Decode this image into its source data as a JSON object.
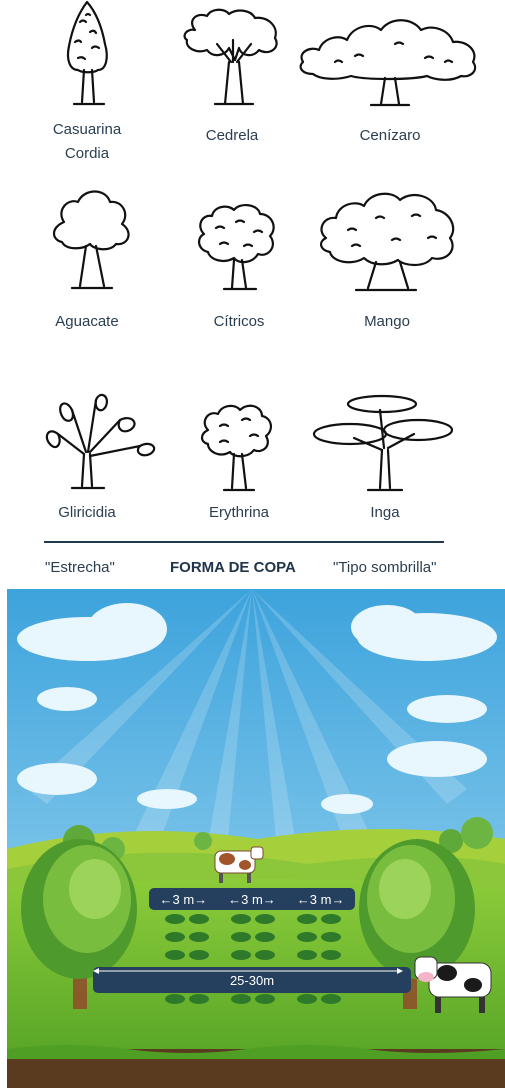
{
  "trees": [
    {
      "label": "Casuarina\nCordia",
      "shape": "narrow-conifer"
    },
    {
      "label": "Cedrela",
      "shape": "vase"
    },
    {
      "label": "Cenízaro",
      "shape": "wide-umbrella"
    },
    {
      "label": "Aguacate",
      "shape": "round-small"
    },
    {
      "label": "Cítricos",
      "shape": "round-dense"
    },
    {
      "label": "Mango",
      "shape": "broad-round"
    },
    {
      "label": "Gliricidia",
      "shape": "fan-leaves"
    },
    {
      "label": "Erythrina",
      "shape": "round-dense"
    },
    {
      "label": "Inga",
      "shape": "layered-umbrella"
    }
  ],
  "axis": {
    "left_label": "\"Estrecha\"",
    "title": "FORMA DE COPA",
    "right_label": "\"Tipo sombrilla\""
  },
  "scene": {
    "spacing_labels": [
      "←3 m→",
      "←3 m→",
      "←3 m→"
    ],
    "row_distance_label": "25-30m",
    "colors": {
      "sky": "#5cb7e8",
      "grass": "#6dbb2f",
      "badge": "#24405e"
    }
  }
}
